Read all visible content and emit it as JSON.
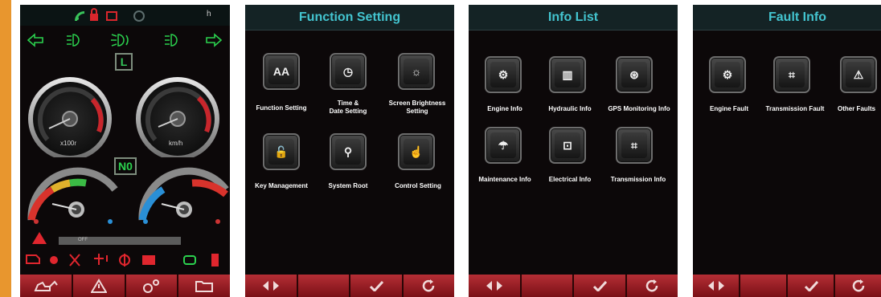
{
  "dashboard": {
    "gear_indicator": "L",
    "gear_position": "N0",
    "tacho_unit": "x100r",
    "speed_unit": "km/h",
    "odo_label": "OFF",
    "status_letter": "h",
    "colors": {
      "green": "#2bd14e",
      "red": "#e0262e",
      "accent": "#e8962e"
    },
    "warning_icons": [
      "engine-warning-icon",
      "oil-pressure-icon",
      "wrench-icon",
      "axle-icon",
      "transmission-icon",
      "battery-icon",
      "coolant-icon",
      "fuel-icon"
    ],
    "bottom_icons": [
      "excavator-icon",
      "warning-triangle-icon",
      "settings-gears-icon",
      "folder-icon"
    ]
  },
  "function_setting": {
    "title": "Function Setting",
    "items": [
      {
        "label": "Function Setting",
        "glyph": "AA"
      },
      {
        "label": "Time &\nDate Setting",
        "glyph": "◷"
      },
      {
        "label": "Screen Brightness\nSetting",
        "glyph": "☼"
      },
      {
        "label": "Key Management",
        "glyph": "🔓"
      },
      {
        "label": "System Root",
        "glyph": "⚲"
      },
      {
        "label": "Control Setting",
        "glyph": "☝"
      }
    ]
  },
  "info_list": {
    "title": "Info List",
    "items": [
      {
        "label": "Engine Info",
        "glyph": "⚙"
      },
      {
        "label": "Hydraulic Info",
        "glyph": "▥"
      },
      {
        "label": "GPS Monitoring Info",
        "glyph": "⊛"
      },
      {
        "label": "Maintenance Info",
        "glyph": "☂"
      },
      {
        "label": "Electrical Info",
        "glyph": "⊡"
      },
      {
        "label": "Transmission Info",
        "glyph": "⌗"
      }
    ]
  },
  "fault_info": {
    "title": "Fault Info",
    "items": [
      {
        "label": "Engine Fault",
        "glyph": "⚙"
      },
      {
        "label": "Transmission Fault",
        "glyph": "⌗"
      },
      {
        "label": "Other Faults",
        "glyph": "⚠"
      }
    ]
  },
  "menu_bottom": [
    "left-right-arrows-icon",
    "blank",
    "check-icon",
    "refresh-icon"
  ]
}
